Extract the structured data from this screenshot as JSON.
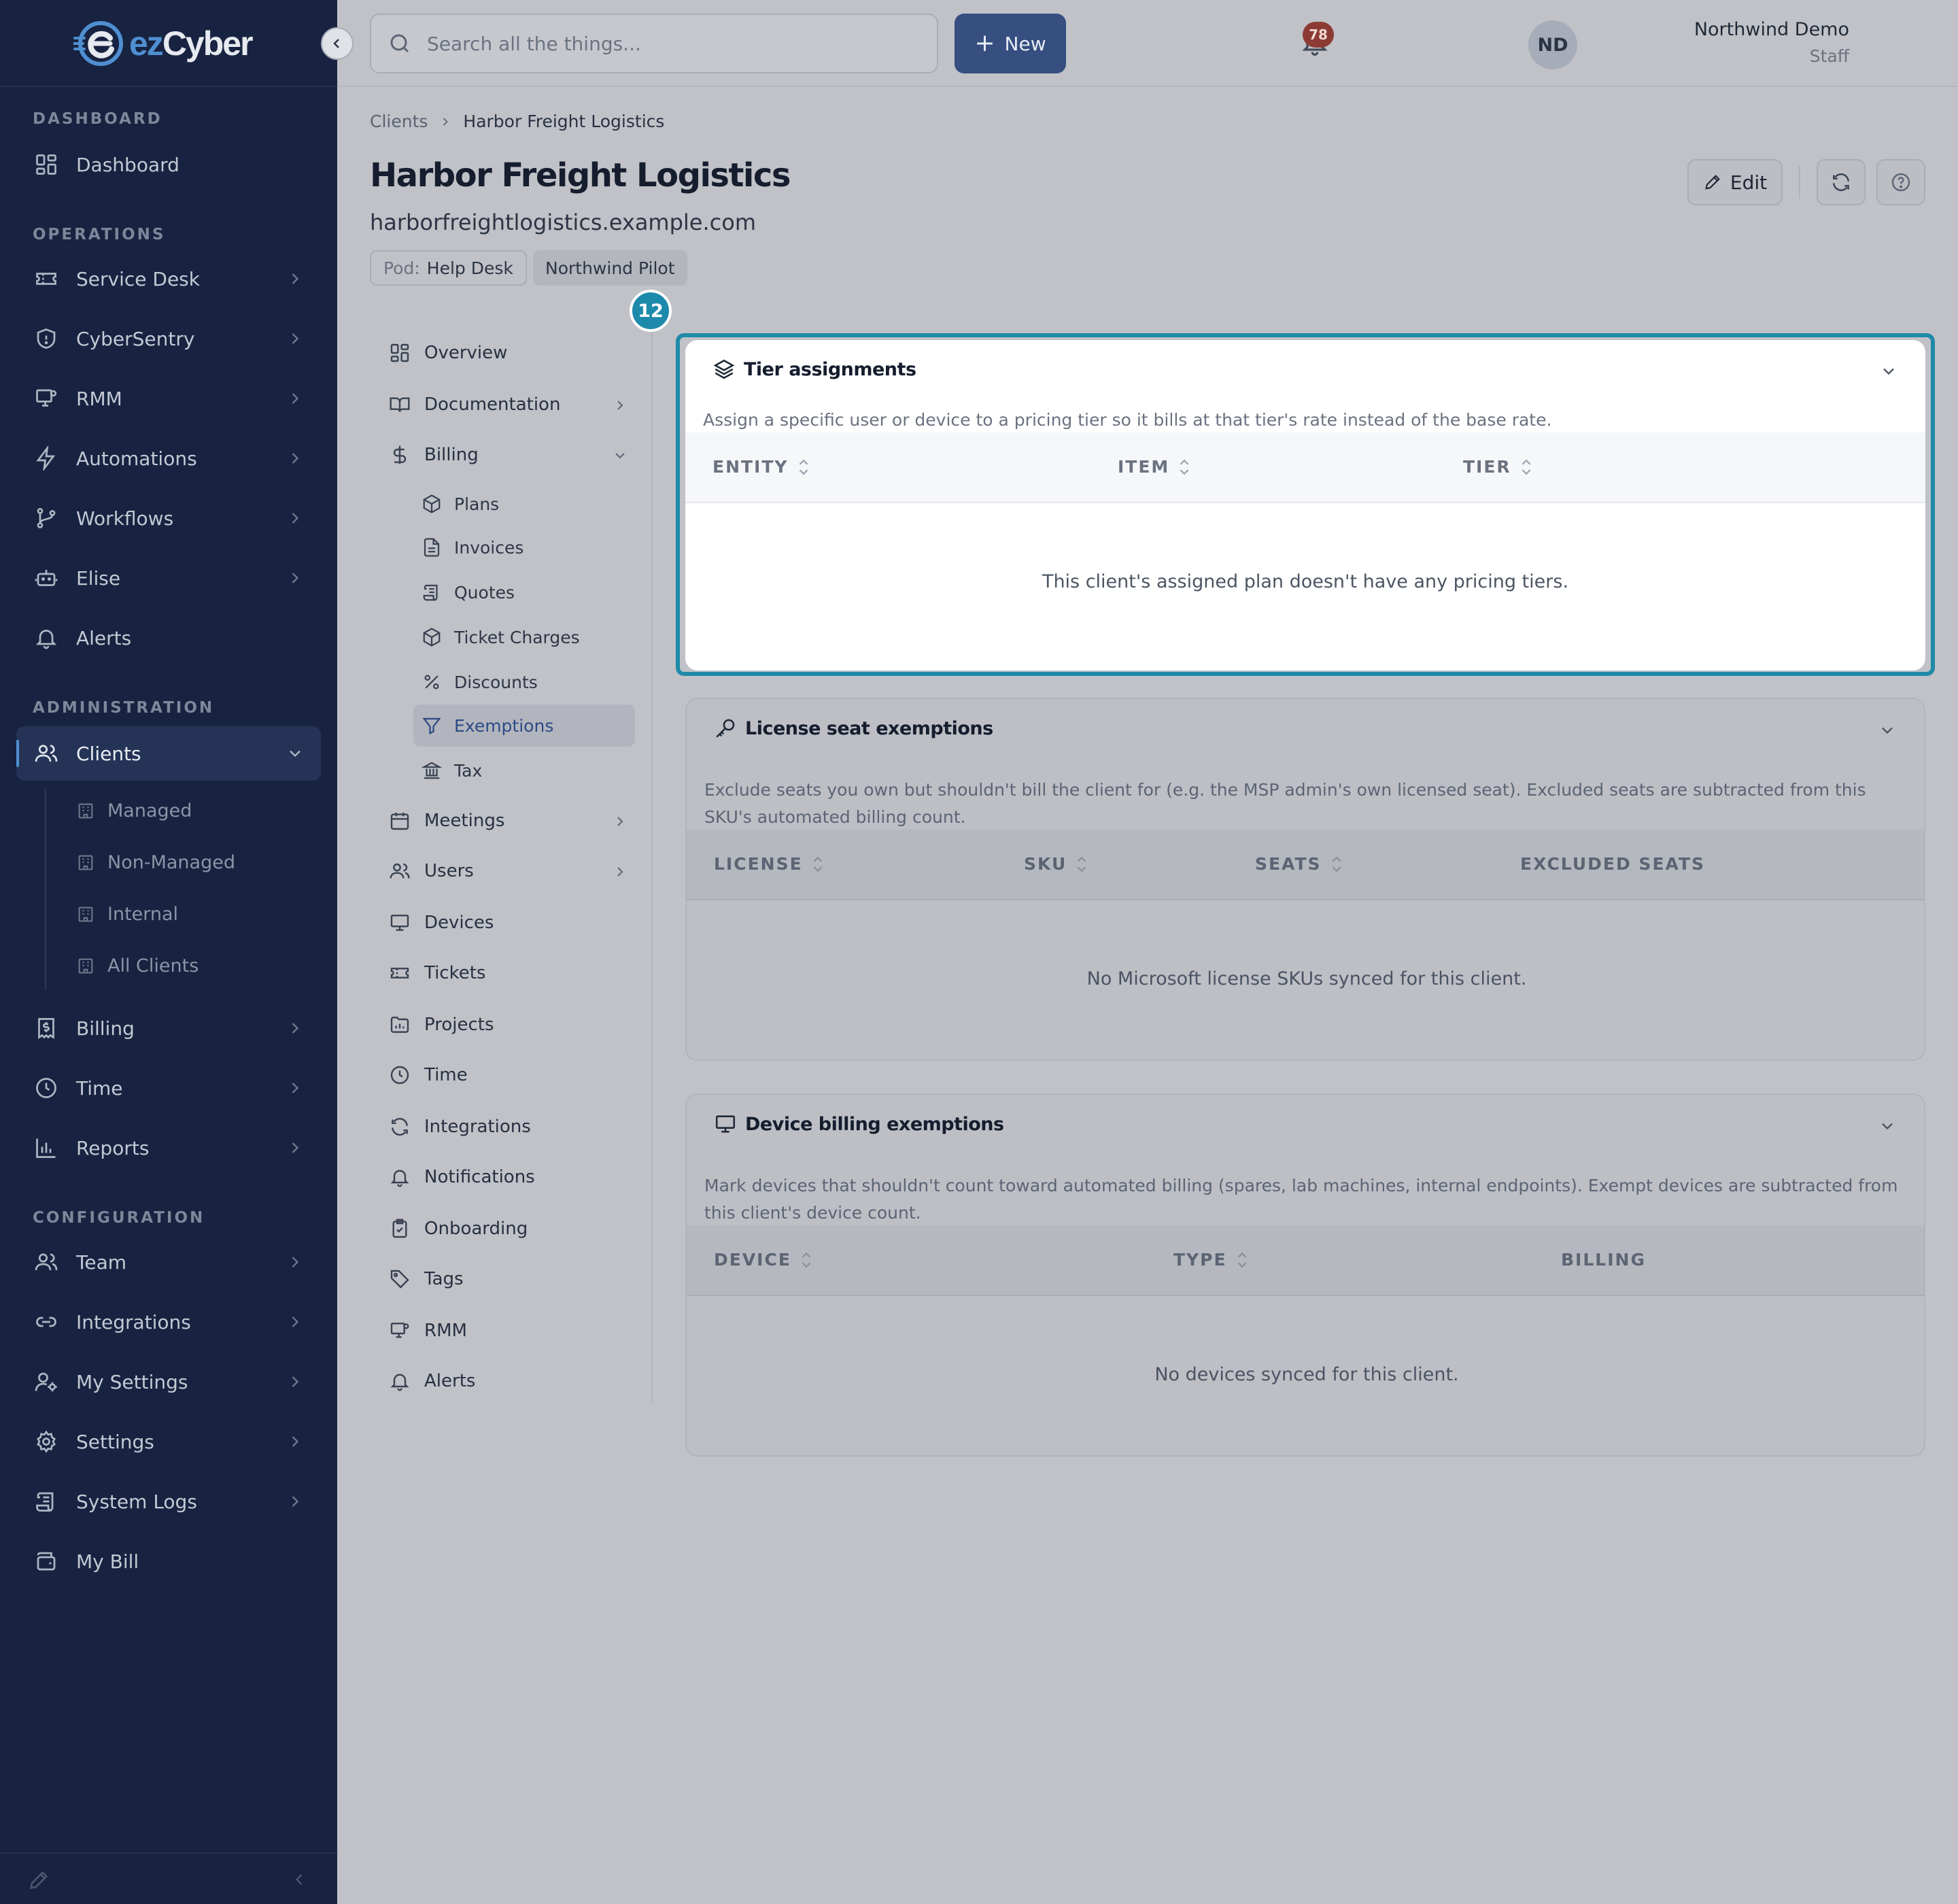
{
  "app": {
    "logo_ez": "ez",
    "logo_cyber": "Cyber",
    "brand_color": "#4f8fd1",
    "sidebar_bg": "#172340"
  },
  "sidebar": {
    "sections": {
      "dashboard": "DASHBOARD",
      "operations": "OPERATIONS",
      "administration": "ADMINISTRATION",
      "configuration": "CONFIGURATION"
    },
    "items": {
      "dashboard": "Dashboard",
      "service_desk": "Service Desk",
      "cybersentry": "CyberSentry",
      "rmm": "RMM",
      "automations": "Automations",
      "workflows": "Workflows",
      "elise": "Elise",
      "alerts": "Alerts",
      "clients": "Clients",
      "billing": "Billing",
      "time": "Time",
      "reports": "Reports",
      "team": "Team",
      "integrations": "Integrations",
      "my_settings": "My Settings",
      "settings": "Settings",
      "system_logs": "System Logs",
      "my_bill": "My Bill"
    },
    "clients_sub": {
      "managed": "Managed",
      "non_managed": "Non-Managed",
      "internal": "Internal",
      "all_clients": "All Clients"
    }
  },
  "topbar": {
    "search_placeholder": "Search all the things...",
    "new_label": "New",
    "notification_count": "78",
    "user_name": "Northwind Demo",
    "user_role": "Staff",
    "avatar_initials": "ND"
  },
  "header": {
    "breadcrumb_root": "Clients",
    "breadcrumb_current": "Harbor Freight Logistics",
    "title": "Harbor Freight Logistics",
    "domain": "harborfreightlogistics.example.com",
    "pod_label": "Pod:",
    "pod_value": "Help Desk",
    "pilot_tag": "Northwind Pilot",
    "edit_label": "Edit"
  },
  "client_nav": {
    "overview": "Overview",
    "documentation": "Documentation",
    "billing": "Billing",
    "billing_sub": {
      "plans": "Plans",
      "invoices": "Invoices",
      "quotes": "Quotes",
      "ticket_charges": "Ticket Charges",
      "discounts": "Discounts",
      "exemptions": "Exemptions",
      "tax": "Tax"
    },
    "meetings": "Meetings",
    "users": "Users",
    "devices": "Devices",
    "tickets": "Tickets",
    "projects": "Projects",
    "time": "Time",
    "integrations": "Integrations",
    "notifications": "Notifications",
    "onboarding": "Onboarding",
    "tags": "Tags",
    "rmm": "RMM",
    "alerts": "Alerts"
  },
  "step_badge": "12",
  "tier_card": {
    "title": "Tier assignments",
    "description": "Assign a specific user or device to a pricing tier so it bills at that tier's rate instead of the base rate.",
    "columns": [
      "ENTITY",
      "ITEM",
      "TIER"
    ],
    "empty": "This client's assigned plan doesn't have any pricing tiers."
  },
  "license_card": {
    "title": "License seat exemptions",
    "description": "Exclude seats you own but shouldn't bill the client for (e.g. the MSP admin's own licensed seat). Excluded seats are subtracted from this SKU's automated billing count.",
    "columns": [
      "LICENSE",
      "SKU",
      "SEATS",
      "EXCLUDED SEATS"
    ],
    "empty": "No Microsoft license SKUs synced for this client."
  },
  "device_card": {
    "title": "Device billing exemptions",
    "description": "Mark devices that shouldn't count toward automated billing (spares, lab machines, internal endpoints). Exempt devices are subtracted from this client's device count.",
    "columns": [
      "DEVICE",
      "TYPE",
      "BILLING"
    ],
    "empty": "No devices synced for this client."
  }
}
